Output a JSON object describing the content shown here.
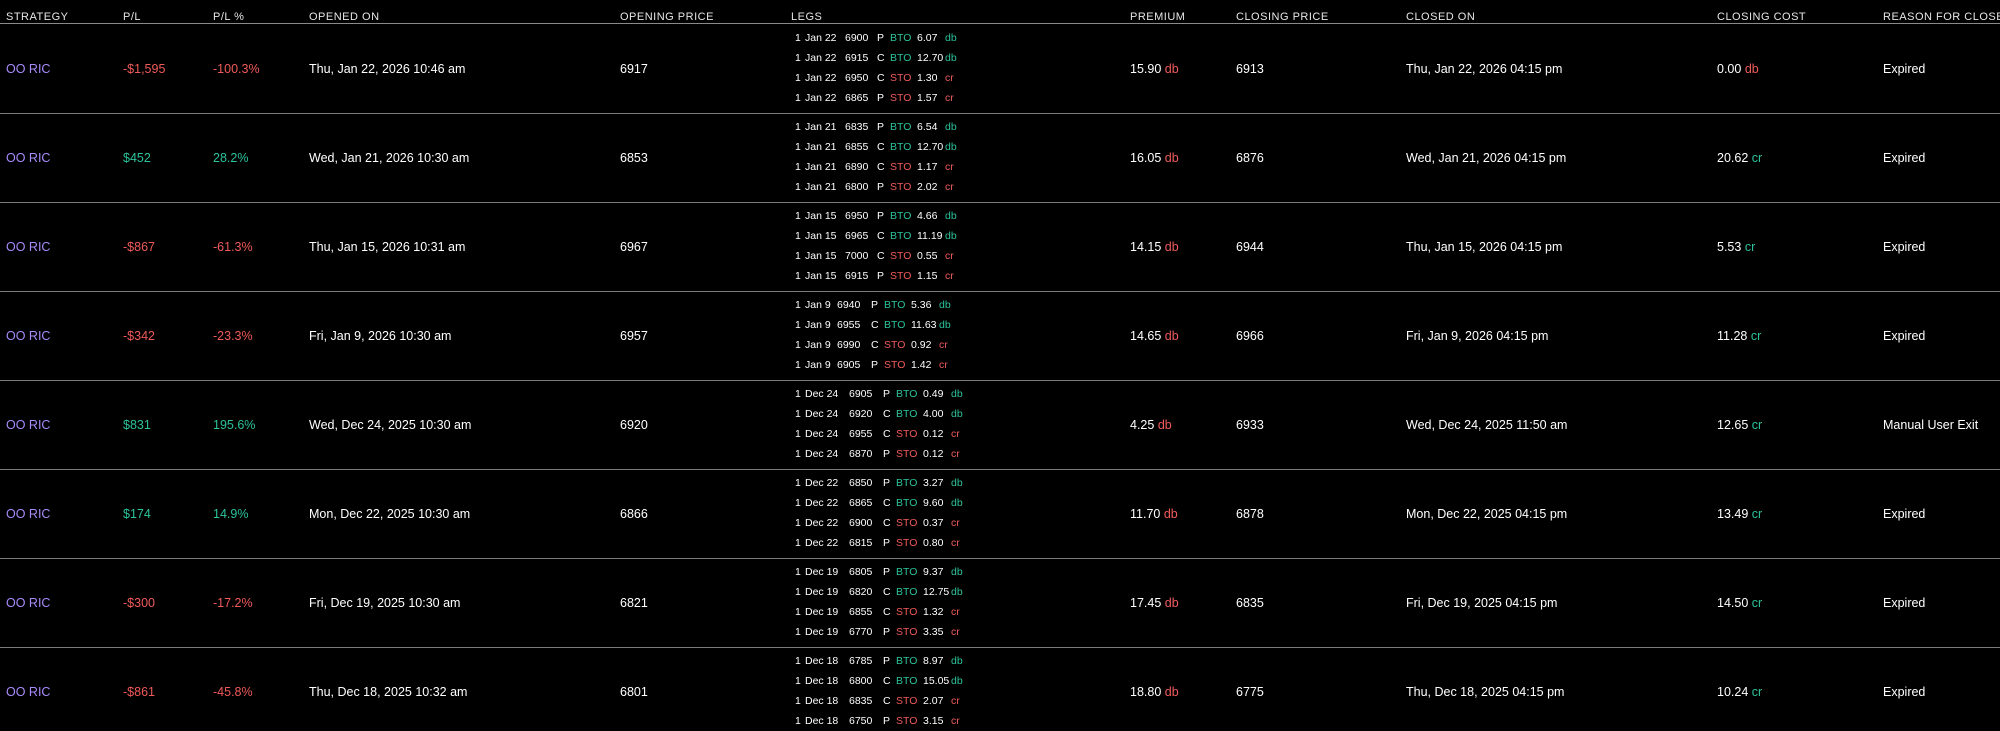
{
  "headers": [
    "STRATEGY",
    "P/L",
    "P/L %",
    "OPENED ON",
    "OPENING PRICE",
    "LEGS",
    "PREMIUM",
    "CLOSING PRICE",
    "CLOSED ON",
    "CLOSING COST",
    "REASON FOR CLOSE"
  ],
  "colors": {
    "purple": "#a78bfa",
    "red": "#f05a5a",
    "green": "#2cc39a",
    "background": "#000000"
  },
  "rows": [
    {
      "strategy": "OO RIC",
      "pl": "-$1,595",
      "pl_pct": "-100.3%",
      "pl_sign": "neg",
      "opened_on": "Thu, Jan 22, 2026 10:46 am",
      "opening_price": "6917",
      "legs": [
        {
          "qty": "1",
          "date": "Jan 22",
          "strike": "6900",
          "type": "P",
          "action": "BTO",
          "price": "6.07",
          "suffix": "db"
        },
        {
          "qty": "1",
          "date": "Jan 22",
          "strike": "6915",
          "type": "C",
          "action": "BTO",
          "price": "12.70",
          "suffix": "db"
        },
        {
          "qty": "1",
          "date": "Jan 22",
          "strike": "6950",
          "type": "C",
          "action": "STO",
          "price": "1.30",
          "suffix": "cr"
        },
        {
          "qty": "1",
          "date": "Jan 22",
          "strike": "6865",
          "type": "P",
          "action": "STO",
          "price": "1.57",
          "suffix": "cr"
        }
      ],
      "premium": "15.90",
      "premium_suffix": "db",
      "closing_price": "6913",
      "closed_on": "Thu, Jan 22, 2026 04:15 pm",
      "closing_cost": "0.00",
      "closing_cost_suffix": "db",
      "reason": "Expired"
    },
    {
      "strategy": "OO RIC",
      "pl": "$452",
      "pl_pct": "28.2%",
      "pl_sign": "pos",
      "opened_on": "Wed, Jan 21, 2026 10:30 am",
      "opening_price": "6853",
      "legs": [
        {
          "qty": "1",
          "date": "Jan 21",
          "strike": "6835",
          "type": "P",
          "action": "BTO",
          "price": "6.54",
          "suffix": "db"
        },
        {
          "qty": "1",
          "date": "Jan 21",
          "strike": "6855",
          "type": "C",
          "action": "BTO",
          "price": "12.70",
          "suffix": "db"
        },
        {
          "qty": "1",
          "date": "Jan 21",
          "strike": "6890",
          "type": "C",
          "action": "STO",
          "price": "1.17",
          "suffix": "cr"
        },
        {
          "qty": "1",
          "date": "Jan 21",
          "strike": "6800",
          "type": "P",
          "action": "STO",
          "price": "2.02",
          "suffix": "cr"
        }
      ],
      "premium": "16.05",
      "premium_suffix": "db",
      "closing_price": "6876",
      "closed_on": "Wed, Jan 21, 2026 04:15 pm",
      "closing_cost": "20.62",
      "closing_cost_suffix": "cr",
      "reason": "Expired"
    },
    {
      "strategy": "OO RIC",
      "pl": "-$867",
      "pl_pct": "-61.3%",
      "pl_sign": "neg",
      "opened_on": "Thu, Jan 15, 2026 10:31 am",
      "opening_price": "6967",
      "legs": [
        {
          "qty": "1",
          "date": "Jan 15",
          "strike": "6950",
          "type": "P",
          "action": "BTO",
          "price": "4.66",
          "suffix": "db"
        },
        {
          "qty": "1",
          "date": "Jan 15",
          "strike": "6965",
          "type": "C",
          "action": "BTO",
          "price": "11.19",
          "suffix": "db"
        },
        {
          "qty": "1",
          "date": "Jan 15",
          "strike": "7000",
          "type": "C",
          "action": "STO",
          "price": "0.55",
          "suffix": "cr"
        },
        {
          "qty": "1",
          "date": "Jan 15",
          "strike": "6915",
          "type": "P",
          "action": "STO",
          "price": "1.15",
          "suffix": "cr"
        }
      ],
      "premium": "14.15",
      "premium_suffix": "db",
      "closing_price": "6944",
      "closed_on": "Thu, Jan 15, 2026 04:15 pm",
      "closing_cost": "5.53",
      "closing_cost_suffix": "cr",
      "reason": "Expired"
    },
    {
      "strategy": "OO RIC",
      "pl": "-$342",
      "pl_pct": "-23.3%",
      "pl_sign": "neg",
      "opened_on": "Fri, Jan 9, 2026 10:30 am",
      "opening_price": "6957",
      "legs": [
        {
          "qty": "1",
          "date": "Jan 9",
          "strike": "6940",
          "type": "P",
          "action": "BTO",
          "price": "5.36",
          "suffix": "db"
        },
        {
          "qty": "1",
          "date": "Jan 9",
          "strike": "6955",
          "type": "C",
          "action": "BTO",
          "price": "11.63",
          "suffix": "db"
        },
        {
          "qty": "1",
          "date": "Jan 9",
          "strike": "6990",
          "type": "C",
          "action": "STO",
          "price": "0.92",
          "suffix": "cr"
        },
        {
          "qty": "1",
          "date": "Jan 9",
          "strike": "6905",
          "type": "P",
          "action": "STO",
          "price": "1.42",
          "suffix": "cr"
        }
      ],
      "premium": "14.65",
      "premium_suffix": "db",
      "closing_price": "6966",
      "closed_on": "Fri, Jan 9, 2026 04:15 pm",
      "closing_cost": "11.28",
      "closing_cost_suffix": "cr",
      "reason": "Expired"
    },
    {
      "strategy": "OO RIC",
      "pl": "$831",
      "pl_pct": "195.6%",
      "pl_sign": "pos",
      "opened_on": "Wed, Dec 24, 2025 10:30 am",
      "opening_price": "6920",
      "legs": [
        {
          "qty": "1",
          "date": "Dec 24",
          "strike": "6905",
          "type": "P",
          "action": "BTO",
          "price": "0.49",
          "suffix": "db"
        },
        {
          "qty": "1",
          "date": "Dec 24",
          "strike": "6920",
          "type": "C",
          "action": "BTO",
          "price": "4.00",
          "suffix": "db"
        },
        {
          "qty": "1",
          "date": "Dec 24",
          "strike": "6955",
          "type": "C",
          "action": "STO",
          "price": "0.12",
          "suffix": "cr"
        },
        {
          "qty": "1",
          "date": "Dec 24",
          "strike": "6870",
          "type": "P",
          "action": "STO",
          "price": "0.12",
          "suffix": "cr"
        }
      ],
      "premium": "4.25",
      "premium_suffix": "db",
      "closing_price": "6933",
      "closed_on": "Wed, Dec 24, 2025 11:50 am",
      "closing_cost": "12.65",
      "closing_cost_suffix": "cr",
      "reason": "Manual User Exit"
    },
    {
      "strategy": "OO RIC",
      "pl": "$174",
      "pl_pct": "14.9%",
      "pl_sign": "pos",
      "opened_on": "Mon, Dec 22, 2025 10:30 am",
      "opening_price": "6866",
      "legs": [
        {
          "qty": "1",
          "date": "Dec 22",
          "strike": "6850",
          "type": "P",
          "action": "BTO",
          "price": "3.27",
          "suffix": "db"
        },
        {
          "qty": "1",
          "date": "Dec 22",
          "strike": "6865",
          "type": "C",
          "action": "BTO",
          "price": "9.60",
          "suffix": "db"
        },
        {
          "qty": "1",
          "date": "Dec 22",
          "strike": "6900",
          "type": "C",
          "action": "STO",
          "price": "0.37",
          "suffix": "cr"
        },
        {
          "qty": "1",
          "date": "Dec 22",
          "strike": "6815",
          "type": "P",
          "action": "STO",
          "price": "0.80",
          "suffix": "cr"
        }
      ],
      "premium": "11.70",
      "premium_suffix": "db",
      "closing_price": "6878",
      "closed_on": "Mon, Dec 22, 2025 04:15 pm",
      "closing_cost": "13.49",
      "closing_cost_suffix": "cr",
      "reason": "Expired"
    },
    {
      "strategy": "OO RIC",
      "pl": "-$300",
      "pl_pct": "-17.2%",
      "pl_sign": "neg",
      "opened_on": "Fri, Dec 19, 2025 10:30 am",
      "opening_price": "6821",
      "legs": [
        {
          "qty": "1",
          "date": "Dec 19",
          "strike": "6805",
          "type": "P",
          "action": "BTO",
          "price": "9.37",
          "suffix": "db"
        },
        {
          "qty": "1",
          "date": "Dec 19",
          "strike": "6820",
          "type": "C",
          "action": "BTO",
          "price": "12.75",
          "suffix": "db"
        },
        {
          "qty": "1",
          "date": "Dec 19",
          "strike": "6855",
          "type": "C",
          "action": "STO",
          "price": "1.32",
          "suffix": "cr"
        },
        {
          "qty": "1",
          "date": "Dec 19",
          "strike": "6770",
          "type": "P",
          "action": "STO",
          "price": "3.35",
          "suffix": "cr"
        }
      ],
      "premium": "17.45",
      "premium_suffix": "db",
      "closing_price": "6835",
      "closed_on": "Fri, Dec 19, 2025 04:15 pm",
      "closing_cost": "14.50",
      "closing_cost_suffix": "cr",
      "reason": "Expired"
    },
    {
      "strategy": "OO RIC",
      "pl": "-$861",
      "pl_pct": "-45.8%",
      "pl_sign": "neg",
      "opened_on": "Thu, Dec 18, 2025 10:32 am",
      "opening_price": "6801",
      "legs": [
        {
          "qty": "1",
          "date": "Dec 18",
          "strike": "6785",
          "type": "P",
          "action": "BTO",
          "price": "8.97",
          "suffix": "db"
        },
        {
          "qty": "1",
          "date": "Dec 18",
          "strike": "6800",
          "type": "C",
          "action": "BTO",
          "price": "15.05",
          "suffix": "db"
        },
        {
          "qty": "1",
          "date": "Dec 18",
          "strike": "6835",
          "type": "C",
          "action": "STO",
          "price": "2.07",
          "suffix": "cr"
        },
        {
          "qty": "1",
          "date": "Dec 18",
          "strike": "6750",
          "type": "P",
          "action": "STO",
          "price": "3.15",
          "suffix": "cr"
        }
      ],
      "premium": "18.80",
      "premium_suffix": "db",
      "closing_price": "6775",
      "closed_on": "Thu, Dec 18, 2025 04:15 pm",
      "closing_cost": "10.24",
      "closing_cost_suffix": "cr",
      "reason": "Expired"
    }
  ]
}
